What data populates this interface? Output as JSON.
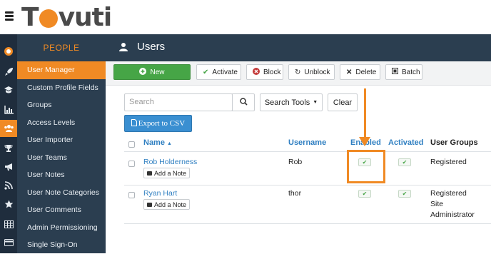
{
  "app": {
    "logo_text": "Tovuti"
  },
  "iconbar": {
    "icons": [
      "logo-icon",
      "rocket-icon",
      "graduation-cap-icon",
      "bar-chart-icon",
      "users-icon",
      "trophy-icon",
      "megaphone-icon",
      "rss-icon",
      "star-icon",
      "table-icon",
      "credit-card-icon"
    ]
  },
  "sidebar": {
    "heading": "PEOPLE",
    "items": [
      {
        "label": "User Manager",
        "active": true
      },
      {
        "label": "Custom Profile Fields"
      },
      {
        "label": "Groups"
      },
      {
        "label": "Access Levels"
      },
      {
        "label": "User Importer"
      },
      {
        "label": "User Teams"
      },
      {
        "label": "User Notes"
      },
      {
        "label": "User Note Categories"
      },
      {
        "label": "User Comments"
      },
      {
        "label": "Admin Permissioning"
      },
      {
        "label": "Single Sign-On"
      }
    ]
  },
  "header": {
    "title": "Users",
    "icon": "user-icon"
  },
  "toolbar": {
    "new": "New",
    "activate": "Activate",
    "block": "Block",
    "unblock": "Unblock",
    "delete": "Delete",
    "batch": "Batch"
  },
  "filters": {
    "search_placeholder": "Search",
    "search_tools": "Search Tools",
    "clear": "Clear",
    "export": "Export to CSV"
  },
  "table": {
    "columns": {
      "name": "Name",
      "username": "Username",
      "enabled": "Enabled",
      "activated": "Activated",
      "groups": "User Groups"
    },
    "add_note": "Add a Note",
    "rows": [
      {
        "name": "Rob Holderness",
        "username": "Rob",
        "enabled": true,
        "activated": true,
        "groups": [
          "Registered"
        ]
      },
      {
        "name": "Ryan Hart",
        "username": "thor",
        "enabled": true,
        "activated": true,
        "groups": [
          "Registered",
          "Site",
          "Administrator"
        ]
      }
    ]
  },
  "colors": {
    "accent": "#f08a24",
    "sidebar": "#2b3e50",
    "link": "#2f7fc1",
    "success": "#46a546"
  }
}
